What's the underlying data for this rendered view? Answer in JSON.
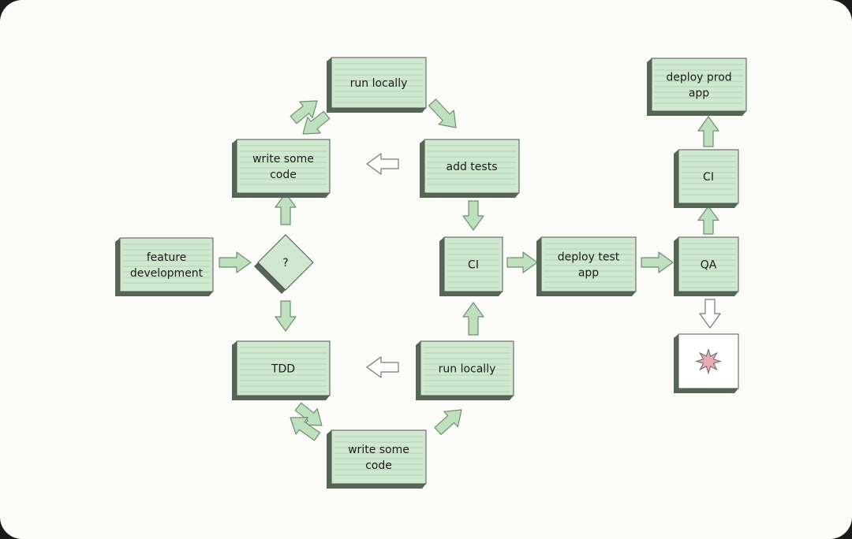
{
  "colors": {
    "box_fill": "#cfe8cf",
    "box_side": "#556655",
    "arrow_green": "#bfe0bf",
    "arrow_stroke": "#6f8f6f",
    "star": "#e7a9b2",
    "background": "#fbfbf8"
  },
  "nodes": {
    "run_locally_top": {
      "label": [
        "run locally"
      ]
    },
    "write_code_top": {
      "label": [
        "write some",
        "code"
      ]
    },
    "add_tests": {
      "label": [
        "add tests"
      ]
    },
    "feature_dev": {
      "label": [
        "feature",
        "development"
      ]
    },
    "decision": {
      "label": [
        "?"
      ]
    },
    "ci_mid": {
      "label": [
        "CI"
      ]
    },
    "deploy_test": {
      "label": [
        "deploy test",
        "app"
      ]
    },
    "qa": {
      "label": [
        "QA"
      ]
    },
    "ci_right": {
      "label": [
        "CI"
      ]
    },
    "deploy_prod": {
      "label": [
        "deploy prod",
        "app"
      ]
    },
    "failure": {
      "label": [],
      "icon": "explosion-star-icon"
    },
    "tdd": {
      "label": [
        "TDD"
      ]
    },
    "run_locally_bottom": {
      "label": [
        "run locally"
      ]
    },
    "write_code_bottom": {
      "label": [
        "write some",
        "code"
      ]
    }
  },
  "edges": [
    {
      "from": "feature_dev",
      "to": "decision",
      "style": "green"
    },
    {
      "from": "decision",
      "to": "write_code_top",
      "style": "green"
    },
    {
      "from": "decision",
      "to": "tdd",
      "style": "green"
    },
    {
      "from": "write_code_top",
      "to": "run_locally_top",
      "style": "green"
    },
    {
      "from": "run_locally_top",
      "to": "write_code_top",
      "style": "green"
    },
    {
      "from": "run_locally_top",
      "to": "add_tests",
      "style": "green"
    },
    {
      "from": "add_tests",
      "to": "write_code_top",
      "style": "hollow"
    },
    {
      "from": "add_tests",
      "to": "ci_mid",
      "style": "green"
    },
    {
      "from": "tdd",
      "to": "write_code_bottom",
      "style": "green"
    },
    {
      "from": "write_code_bottom",
      "to": "tdd",
      "style": "green"
    },
    {
      "from": "write_code_bottom",
      "to": "run_locally_bottom",
      "style": "green"
    },
    {
      "from": "run_locally_bottom",
      "to": "tdd",
      "style": "hollow"
    },
    {
      "from": "run_locally_bottom",
      "to": "ci_mid",
      "style": "green"
    },
    {
      "from": "ci_mid",
      "to": "deploy_test",
      "style": "green"
    },
    {
      "from": "deploy_test",
      "to": "qa",
      "style": "green"
    },
    {
      "from": "qa",
      "to": "ci_right",
      "style": "green"
    },
    {
      "from": "ci_right",
      "to": "deploy_prod",
      "style": "green"
    },
    {
      "from": "qa",
      "to": "failure",
      "style": "hollow"
    }
  ]
}
